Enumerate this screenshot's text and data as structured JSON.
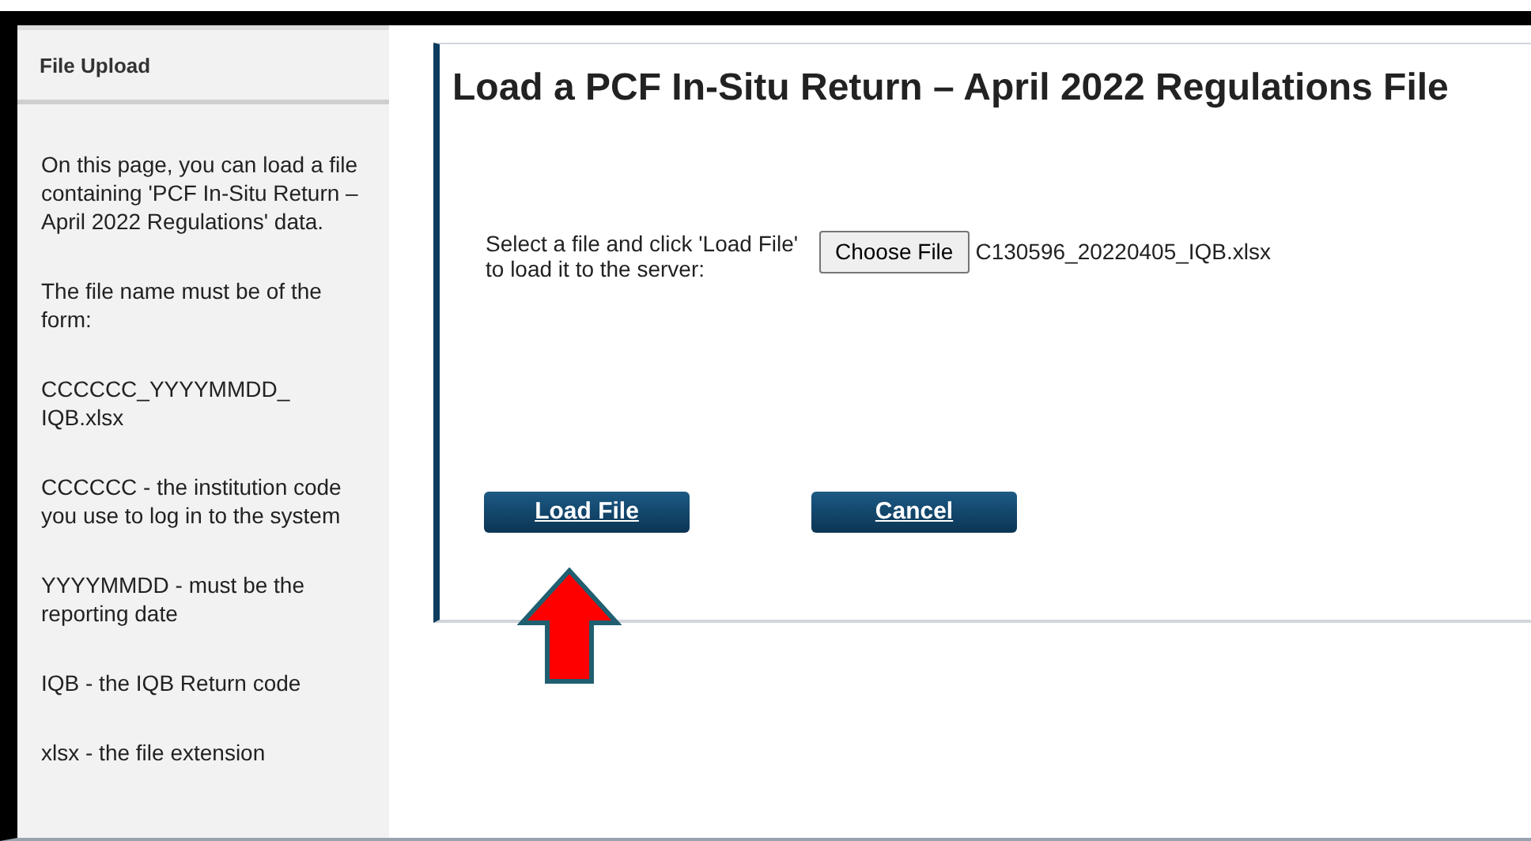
{
  "sidebar": {
    "title": "File Upload",
    "paragraphs": [
      "On this page, you can load a file containing 'PCF In-Situ Return – April 2022 Regulations' data.",
      "The file name must be of the form:",
      "CCCCCC_YYYYMMDD_ IQB.xlsx",
      "CCCCCC - the institution code you use to log in to the system",
      "YYYYMMDD - must be the reporting date",
      "IQB - the IQB Return code",
      "xlsx - the file extension"
    ]
  },
  "main": {
    "title": "Load a PCF In-Situ Return – April 2022 Regulations File",
    "file_label": "Select a file and click 'Load File' to load it to the server:",
    "choose_button": "Choose File",
    "file_name": "C130596_20220405_IQB.xlsx",
    "buttons": [
      "Load File",
      "Cancel"
    ]
  }
}
